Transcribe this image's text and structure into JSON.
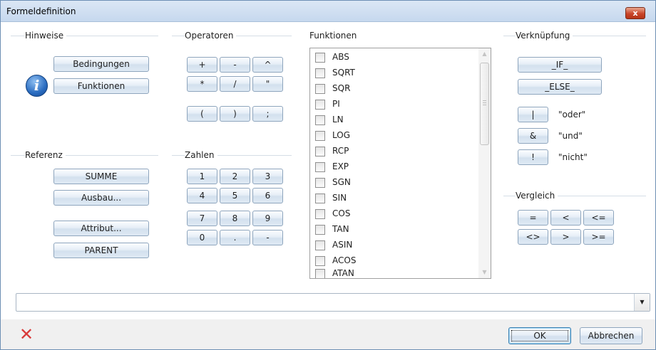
{
  "window": {
    "title": "Formeldefinition",
    "close_label": "x"
  },
  "groups": {
    "hinweise": "Hinweise",
    "operatoren": "Operatoren",
    "funktionen": "Funktionen",
    "verknuepfung": "Verknüpfung",
    "referenz": "Referenz",
    "zahlen": "Zahlen",
    "vergleich": "Vergleich"
  },
  "hinweise": {
    "bedingungen": "Bedingungen",
    "funktionen": "Funktionen",
    "info_glyph": "i"
  },
  "operatoren": {
    "plus": "+",
    "minus": "-",
    "power": "^",
    "multiply": "*",
    "divide": "/",
    "quote": "\"",
    "paren_open": "(",
    "paren_close": ")",
    "semicolon": ";"
  },
  "referenz": {
    "summe": "SUMME",
    "ausbau": "Ausbau...",
    "attribut": "Attribut...",
    "parent": "PARENT"
  },
  "zahlen": [
    "1",
    "2",
    "3",
    "4",
    "5",
    "6",
    "7",
    "8",
    "9",
    "0",
    ".",
    "-"
  ],
  "funktionen_list": [
    "ABS",
    "SQRT",
    "SQR",
    "PI",
    "LN",
    "LOG",
    "RCP",
    "EXP",
    "SGN",
    "SIN",
    "COS",
    "TAN",
    "ASIN",
    "ACOS",
    "ATAN"
  ],
  "verknuepfung": {
    "if": "_IF_",
    "else": "_ELSE_",
    "or_symbol": "|",
    "or_label": "\"oder\"",
    "and_symbol": "&",
    "and_label": "\"und\"",
    "not_symbol": "!",
    "not_label": "\"nicht\""
  },
  "vergleich": {
    "eq": "=",
    "lt": "<",
    "le": "<=",
    "ne": "<>",
    "gt": ">",
    "ge": ">="
  },
  "formula": {
    "value": ""
  },
  "footer": {
    "ok": "OK",
    "cancel": "Abbrechen",
    "delete_glyph": "✕"
  },
  "colors": {
    "titlebar": "#c6d8ee",
    "close": "#c9452a",
    "button_border": "#8ea5bd",
    "delete_red": "#d93a3a",
    "info_blue": "#2a6cc0"
  },
  "icons": {
    "close": "close-icon",
    "info": "info-icon",
    "delete": "delete-icon",
    "dropdown": "chevron-down-icon"
  }
}
